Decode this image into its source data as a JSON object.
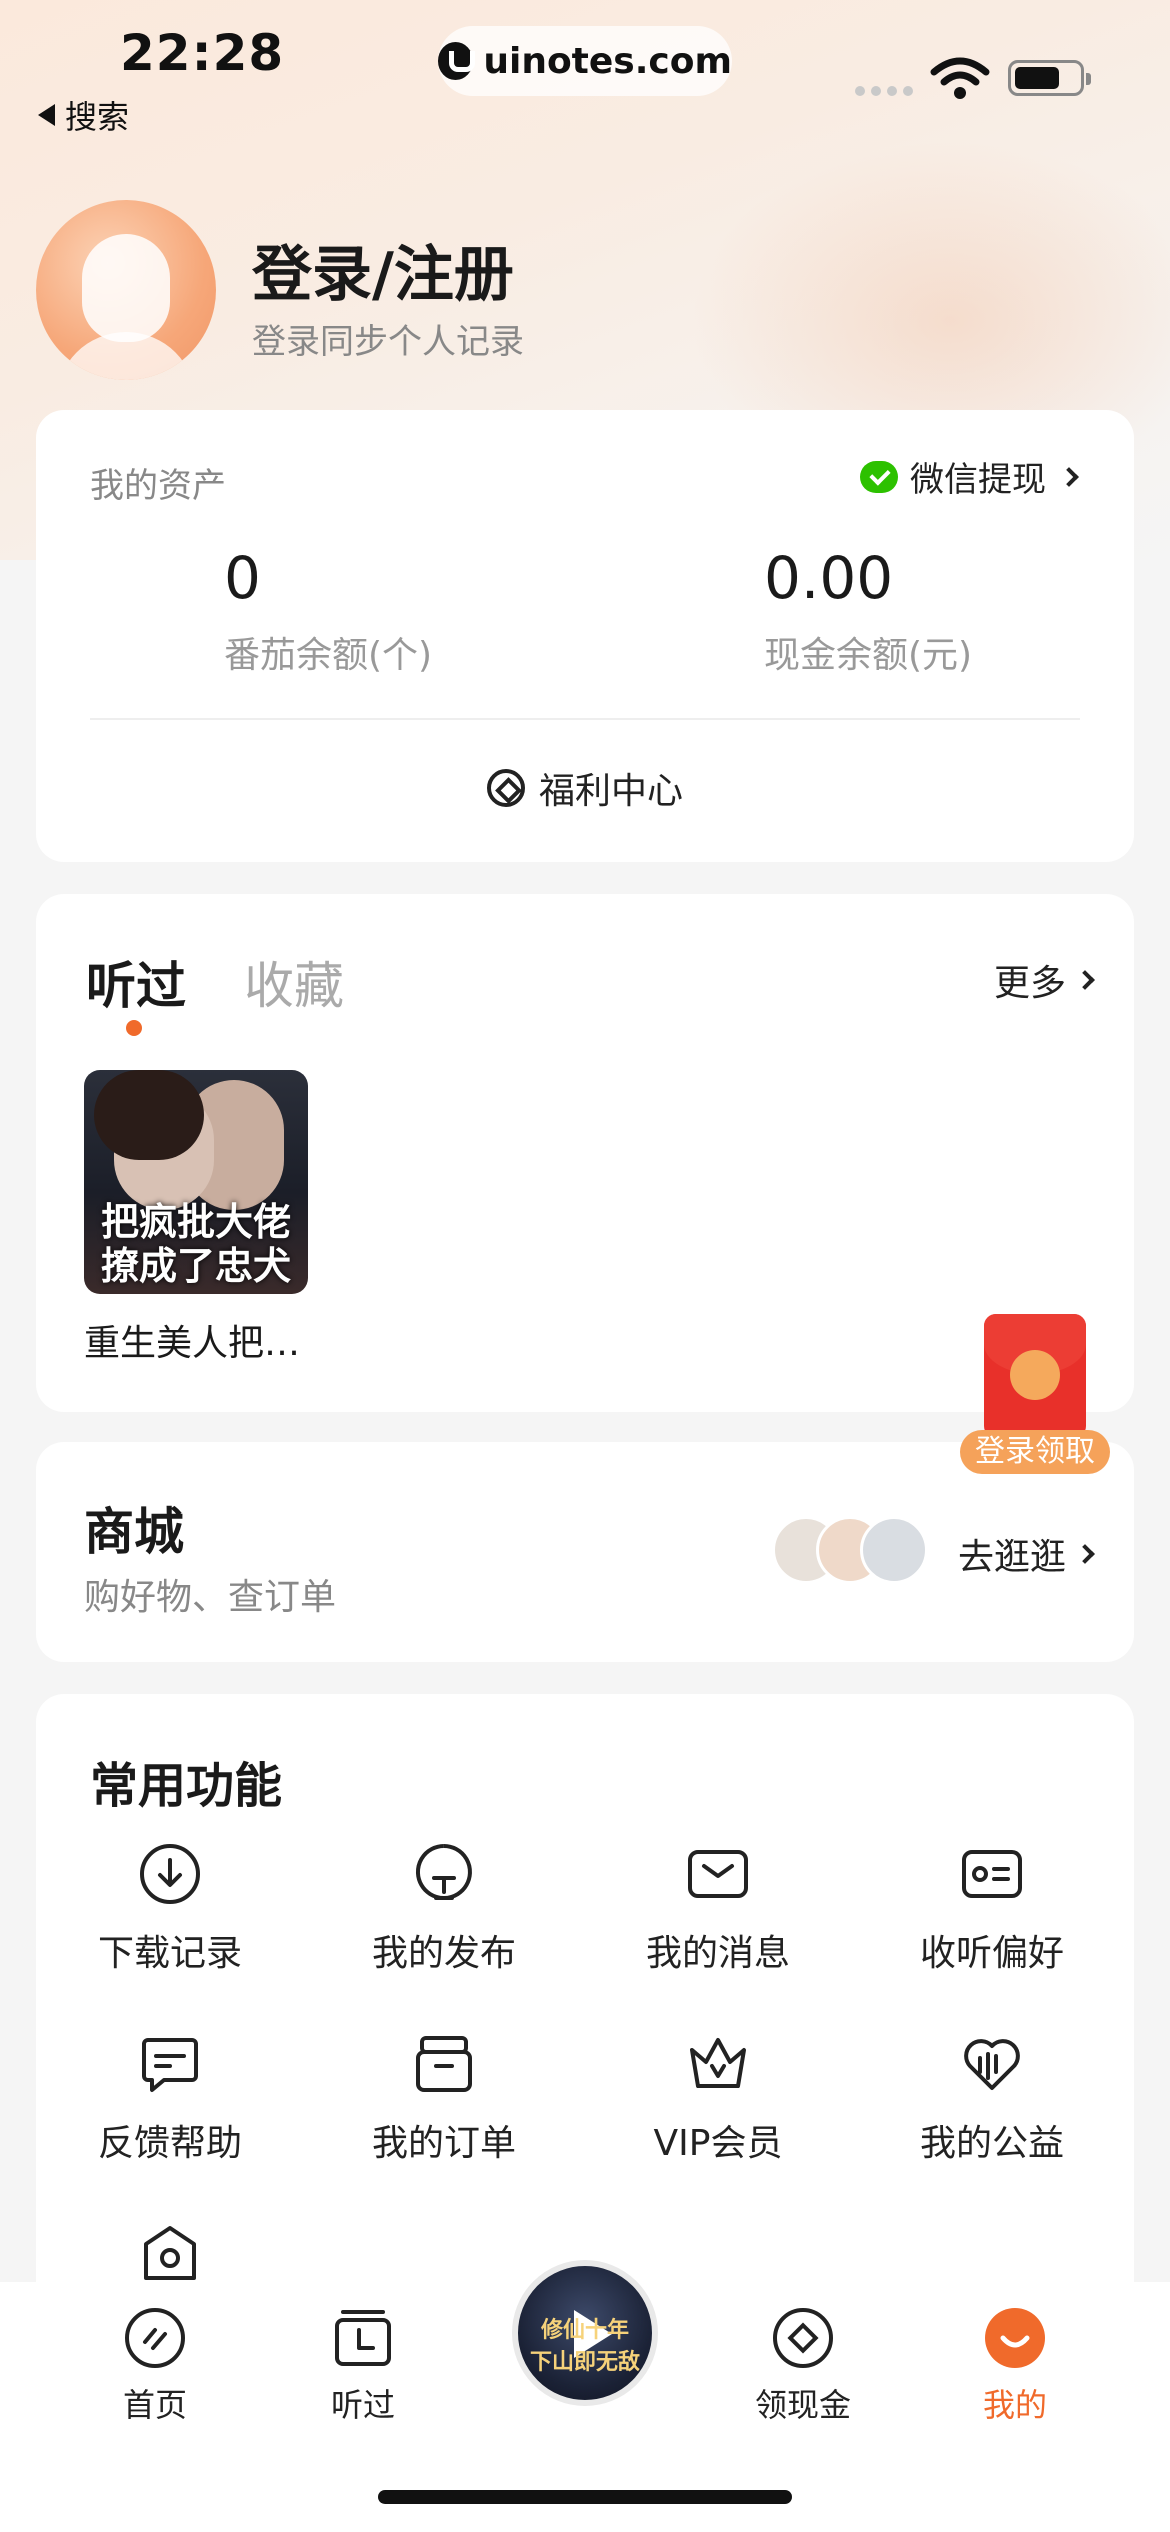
{
  "status_bar": {
    "time": "22:28",
    "back_label": "搜索",
    "url": "uinotes.com"
  },
  "profile": {
    "title": "登录/注册",
    "subtitle": "登录同步个人记录"
  },
  "assets": {
    "label": "我的资产",
    "wechat_withdraw": "微信提现",
    "tomato_value": "0",
    "tomato_label": "番茄余额(个)",
    "cash_value": "0.00",
    "cash_label": "现金余额(元)",
    "welfare": "福利中心"
  },
  "history": {
    "tab_active": "听过",
    "tab_inactive": "收藏",
    "more": "更多",
    "book": {
      "title": "重生美人把…",
      "cover_text": "把疯批大佬撩成了忠犬"
    }
  },
  "red_packet": {
    "label": "登录领取"
  },
  "shop": {
    "title": "商城",
    "subtitle": "购好物、查订单",
    "go": "去逛逛"
  },
  "functions": {
    "title": "常用功能",
    "items": [
      {
        "label": "下载记录",
        "icon": "download-icon"
      },
      {
        "label": "我的发布",
        "icon": "publish-icon"
      },
      {
        "label": "我的消息",
        "icon": "message-icon"
      },
      {
        "label": "收听偏好",
        "icon": "preference-icon"
      },
      {
        "label": "反馈帮助",
        "icon": "feedback-icon"
      },
      {
        "label": "我的订单",
        "icon": "order-icon"
      },
      {
        "label": "VIP会员",
        "icon": "crown-icon"
      },
      {
        "label": "我的公益",
        "icon": "charity-icon"
      }
    ]
  },
  "bottom_nav": {
    "items": [
      {
        "label": "首页",
        "icon": "home-icon"
      },
      {
        "label": "听过",
        "icon": "history-icon"
      },
      {
        "label": "领现金",
        "icon": "cash-icon"
      },
      {
        "label": "我的",
        "icon": "profile-icon"
      }
    ],
    "active": "我的",
    "player_text": "修仙十年 下山即无敌"
  },
  "colors": {
    "accent": "#f06a2b",
    "wechat": "#2dc100",
    "red_packet": "#e8302a"
  }
}
